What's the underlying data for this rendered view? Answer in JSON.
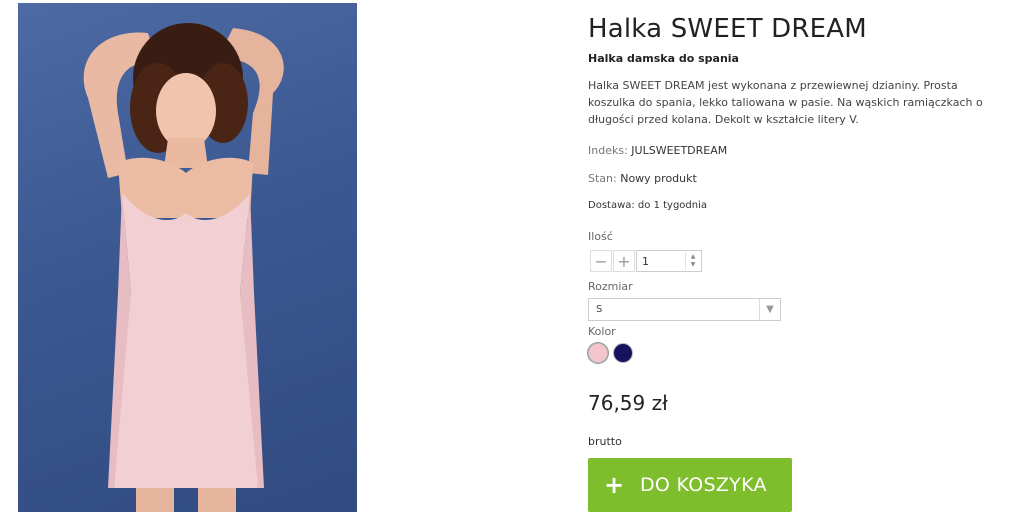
{
  "product": {
    "title": "Halka SWEET DREAM",
    "subtitle": "Halka damska do spania",
    "description": "Halka SWEET DREAM jest wykonana z przewiewnej dzianiny. Prosta koszulka do spania, lekko taliowana w pasie. Na wąskich ramiączkach o długości przed kolana. Dekolt w kształcie litery V.",
    "index_label": "Indeks:",
    "index_value": "JULSWEETDREAM",
    "condition_label": "Stan:",
    "condition_value": "Nowy produkt",
    "delivery": "Dostawa: do 1 tygodnia",
    "price": "76,59 zł",
    "price_note": "brutto"
  },
  "quantity": {
    "label": "Ilość",
    "value": "1",
    "minus_icon": "minus-icon",
    "plus_icon": "plus-icon"
  },
  "size": {
    "label": "Rozmiar",
    "selected": "S"
  },
  "color": {
    "label": "Kolor",
    "options": [
      {
        "name": "pink",
        "hex": "#f4c6cc"
      },
      {
        "name": "navy",
        "hex": "#15125e"
      }
    ]
  },
  "cart_button": {
    "label": "DO KOSZYKA",
    "icon": "plus-icon",
    "color": "#7ebd2b"
  }
}
